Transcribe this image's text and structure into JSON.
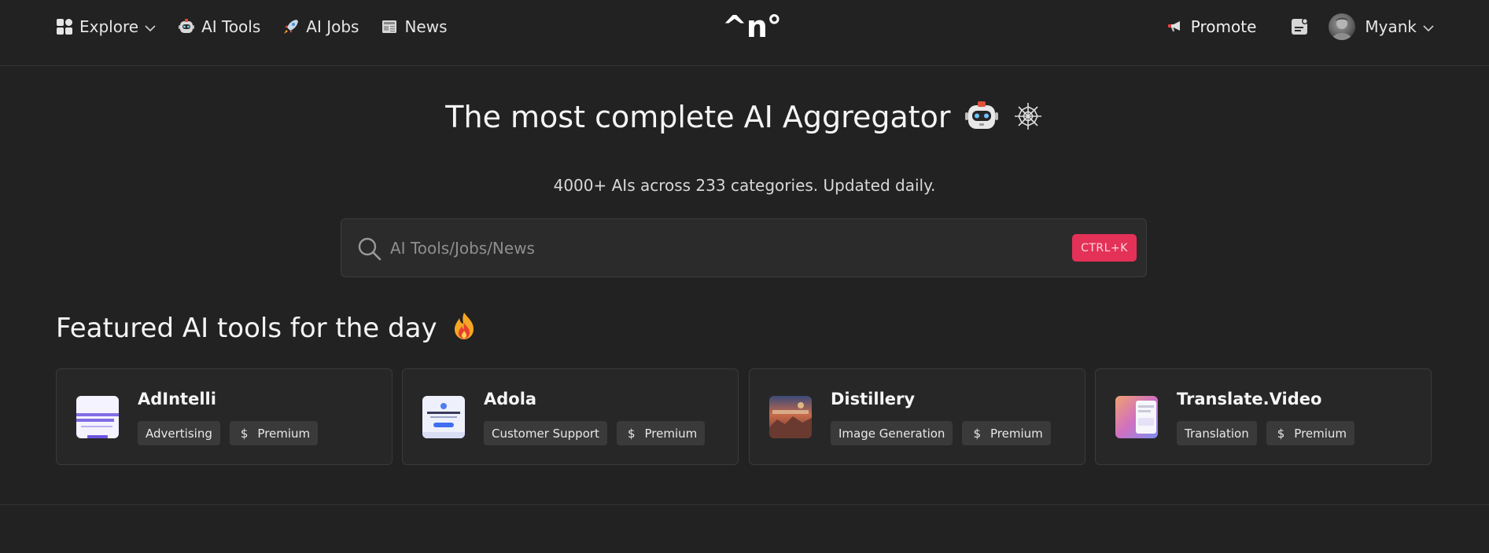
{
  "nav": {
    "explore": "Explore",
    "ai_tools": "AI Tools",
    "ai_jobs": "AI Jobs",
    "news": "News",
    "logo": "^n°",
    "promote": "Promote",
    "user_name": "Myank"
  },
  "hero": {
    "title": "The most complete AI Aggregator",
    "subtitle": "4000+ AIs across 233 categories. Updated daily."
  },
  "search": {
    "placeholder": "AI Tools/Jobs/News",
    "shortcut": "CTRL+K"
  },
  "featured": {
    "title": "Featured AI tools for the day",
    "cards": [
      {
        "name": "AdIntelli",
        "category": "Advertising",
        "pricing": "Premium"
      },
      {
        "name": "Adola",
        "category": "Customer Support",
        "pricing": "Premium"
      },
      {
        "name": "Distillery",
        "category": "Image Generation",
        "pricing": "Premium"
      },
      {
        "name": "Translate.Video",
        "category": "Translation",
        "pricing": "Premium"
      }
    ]
  },
  "colors": {
    "background": "#222222",
    "accent": "#e43157"
  }
}
